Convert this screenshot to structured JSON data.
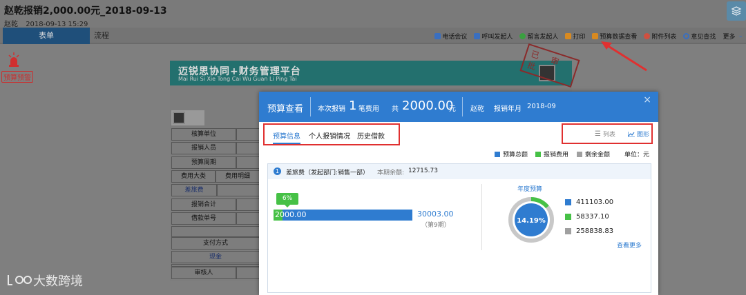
{
  "header": {
    "title": "赵乾报销2,000.00元_2018-09-13",
    "author": "赵乾",
    "datetime": "2018-09-13 15:29"
  },
  "tabs": [
    {
      "label": "表单",
      "active": true
    },
    {
      "label": "流程",
      "active": false
    }
  ],
  "toolbar": [
    {
      "label": "电话会议",
      "icon": "phone-icon",
      "color": "#3a6fc0"
    },
    {
      "label": "呼叫发起人",
      "icon": "call-icon",
      "color": "#3a6fc0"
    },
    {
      "label": "留言发起人",
      "icon": "message-icon",
      "color": "#3aa040"
    },
    {
      "label": "打印",
      "icon": "print-icon",
      "color": "#d98a20"
    },
    {
      "label": "预算数据查看",
      "icon": "budget-icon",
      "color": "#d98a20"
    },
    {
      "label": "附件列表",
      "icon": "attachment-icon",
      "color": "#d05040"
    },
    {
      "label": "意见查找",
      "icon": "search-icon",
      "color": "#3a6fc0"
    },
    {
      "label": "更多",
      "icon": "chevron-down-icon",
      "color": "#3a6fc0"
    }
  ],
  "alert": {
    "label": "预算预警"
  },
  "document": {
    "title": "迈锐思协同+财务管理平台",
    "subtitle": "Mai Rui Si Xie Tong Cai Wu Guan Li Ping Tai",
    "stamp": "已审批",
    "rows": {
      "accounting_unit": "核算单位",
      "claimant": "报销人员",
      "budget_period": "预算周期",
      "expense_category": "费用大类",
      "expense_detail": "费用明细",
      "travel": "差旅费",
      "total": "报销合计",
      "loan_no": "借款单号",
      "payment_method": "支付方式",
      "cash": "现金",
      "reviewer": "审核人"
    }
  },
  "dialog": {
    "title": "预算查看",
    "summary_prefix": "本次报销",
    "count": "1",
    "count_suffix": "笔费用",
    "total_prefix": "共",
    "total_amount": "2000.00",
    "total_unit": "元",
    "claimant": "赵乾",
    "month_label": "报销年月",
    "month": "2018-09",
    "close": "×",
    "subtabs": [
      "预算信息",
      "个人报销情况",
      "历史借款"
    ],
    "view_list": "列表",
    "view_chart": "图形",
    "legend": [
      {
        "label": "预算总额",
        "color": "#2f7cd0"
      },
      {
        "label": "报销费用",
        "color": "#46c146"
      },
      {
        "label": "剩余金额",
        "color": "#a0a0a0"
      }
    ],
    "unit": "单位：元",
    "item": {
      "index": "1",
      "title": "差旅费（发起部门:销售一部）",
      "balance_label": "本期余额:",
      "balance": "12715.73",
      "used": "2000.00",
      "used_pct": "6%",
      "used_fraction": 0.067,
      "budget": "30003.00",
      "period": "（第9期）"
    },
    "annual": {
      "title": "年度预算",
      "center_pct": "14.19%",
      "used_fraction": 0.1419,
      "values": [
        {
          "label": "411103.00",
          "color": "#2f7cd0"
        },
        {
          "label": "58337.10",
          "color": "#46c146"
        },
        {
          "label": "258838.83",
          "color": "#a0a0a0"
        }
      ],
      "more": "查看更多"
    }
  },
  "watermark": "大数跨境"
}
